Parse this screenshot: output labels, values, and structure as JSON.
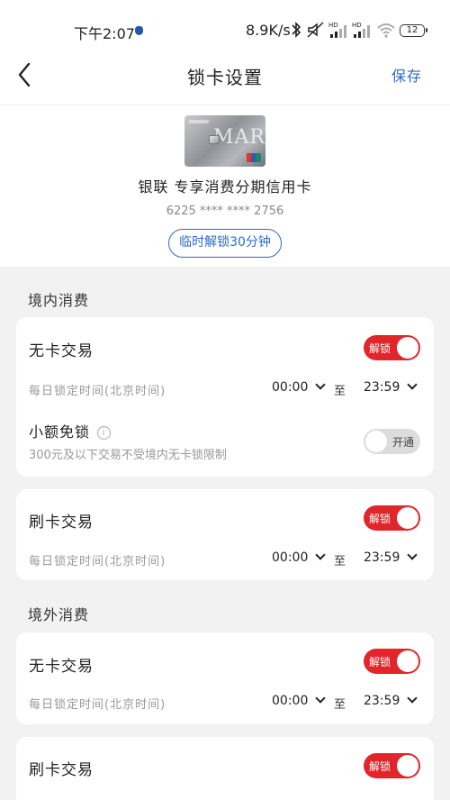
{
  "status_bar": {
    "time": "下午2:07",
    "net_speed": "8.9K/s",
    "battery": "12"
  },
  "nav": {
    "title": "锁卡设置",
    "save_label": "保存"
  },
  "card": {
    "image_text": "MART",
    "name": "银联 专享消费分期信用卡",
    "number": "6225 **** **** 2756",
    "temp_unlock_label": "临时解锁30分钟"
  },
  "domestic": {
    "title": "境内消费",
    "cardless": {
      "label": "无卡交易",
      "toggle_text": "解锁",
      "time_label": "每日锁定时间(北京时间)",
      "start": "00:00",
      "to": "至",
      "end": "23:59"
    },
    "small_amount": {
      "label": "小额免锁",
      "info_glyph": "i",
      "desc": "300元及以下交易不受境内无卡锁限制",
      "toggle_text": "开通"
    },
    "swipe": {
      "label": "刷卡交易",
      "toggle_text": "解锁",
      "time_label": "每日锁定时间(北京时间)",
      "start": "00:00",
      "to": "至",
      "end": "23:59"
    }
  },
  "overseas": {
    "title": "境外消费",
    "cardless": {
      "label": "无卡交易",
      "toggle_text": "解锁",
      "time_label": "每日锁定时间(北京时间)",
      "start": "00:00",
      "to": "至",
      "end": "23:59"
    },
    "swipe": {
      "label": "刷卡交易",
      "toggle_text": "解锁"
    }
  },
  "colors": {
    "accent_blue": "#2d6bc7",
    "toggle_on_red": "#e0262b",
    "toggle_off_gray": "#dcdcdc",
    "background": "#f2f2f2"
  },
  "icons": [
    "back-arrow-icon",
    "info-icon",
    "chevron-down-icon",
    "bluetooth-icon",
    "mute-icon",
    "signal-icon",
    "wifi-icon",
    "battery-icon"
  ]
}
